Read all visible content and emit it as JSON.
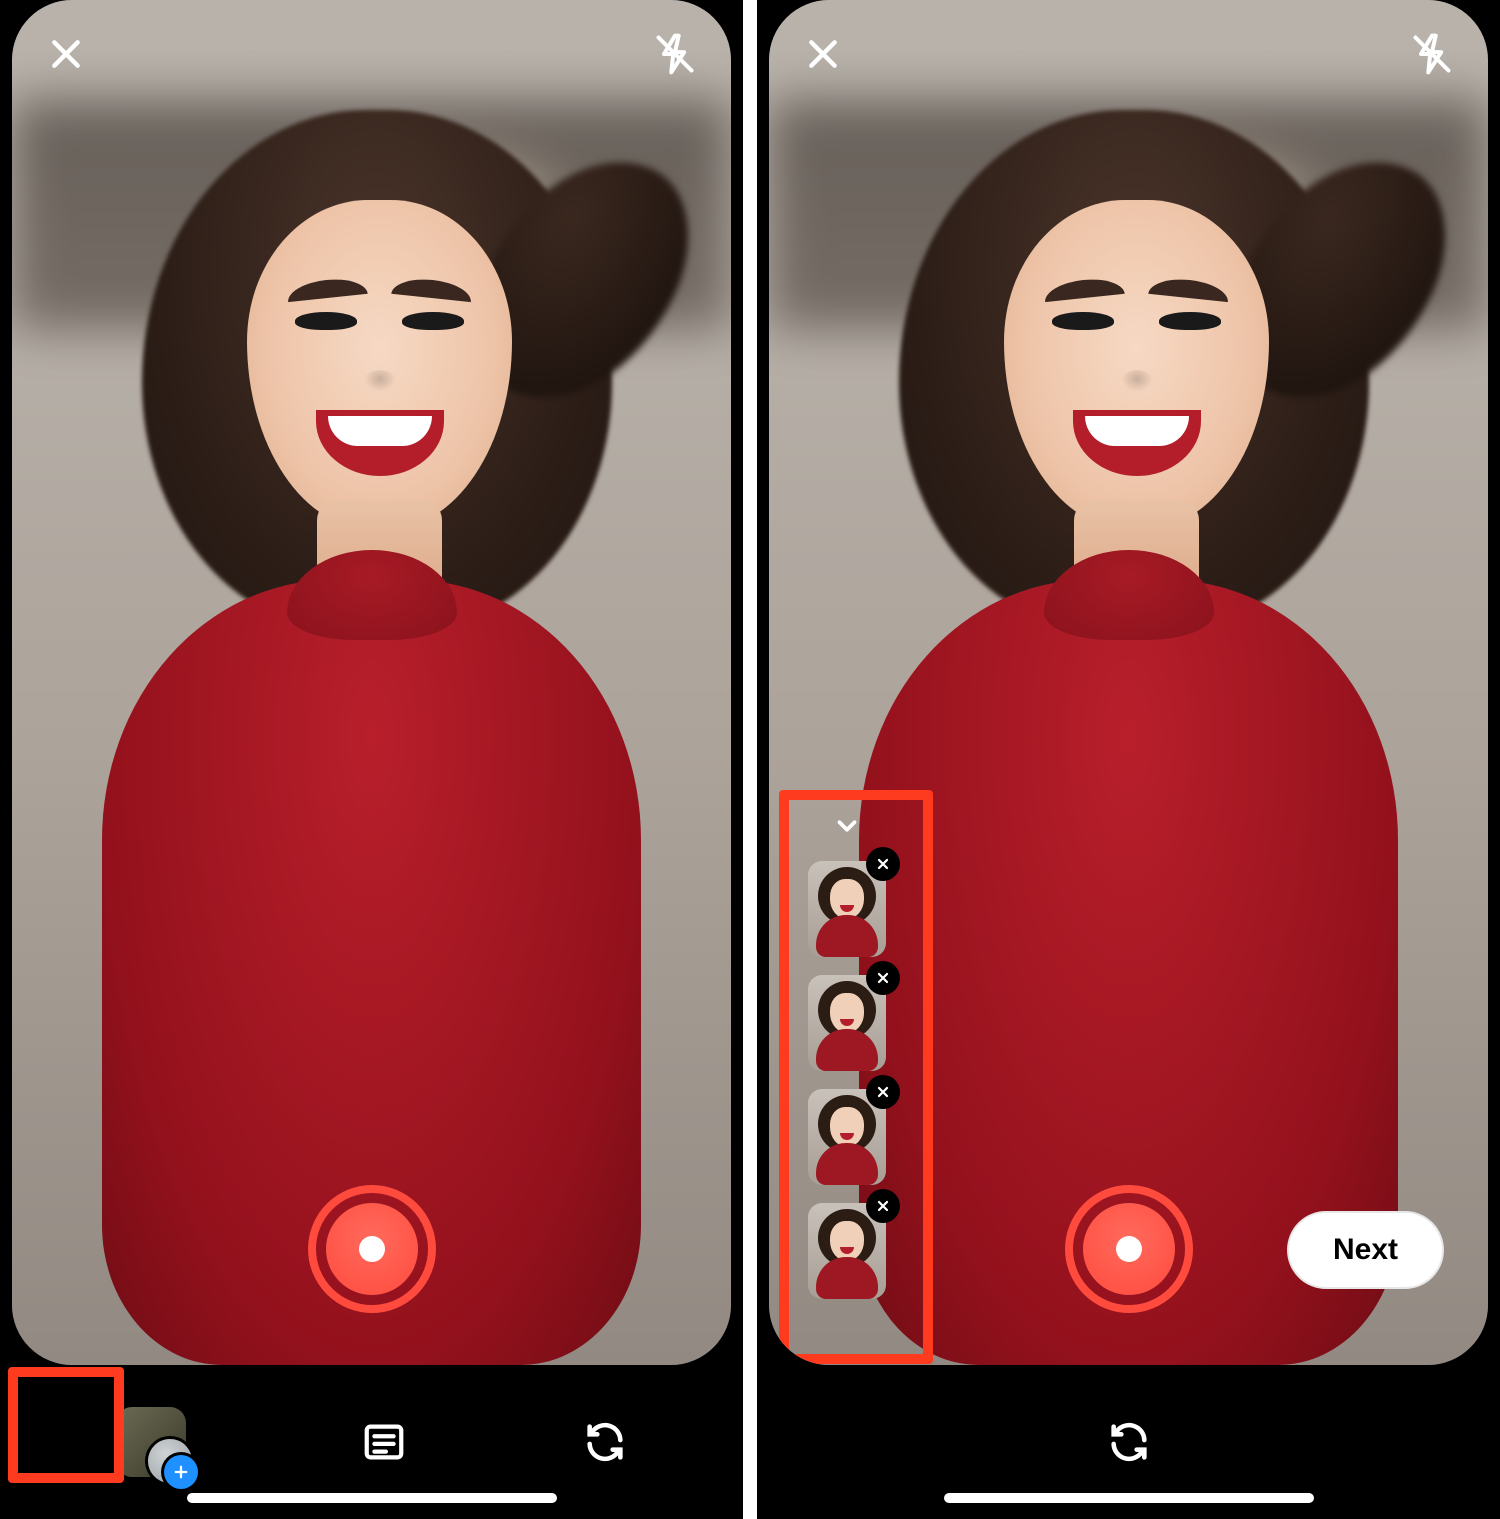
{
  "colors": {
    "accent": "#ff4b3e",
    "highlight": "#ff3b1f",
    "plus": "#1e90ff"
  },
  "left": {
    "close_icon": "close-icon",
    "flash_icon": "flash-off-icon",
    "shutter_icon": "record-shutter",
    "bottom": {
      "gallery_icon": "gallery-add-icon",
      "caption_icon": "text-card-icon",
      "switch_icon": "switch-camera-icon"
    }
  },
  "right": {
    "close_icon": "close-icon",
    "flash_icon": "flash-off-icon",
    "shutter_icon": "record-shutter",
    "next_label": "Next",
    "collapse_icon": "chevron-down-icon",
    "thumbs": [
      {
        "remove_icon": "remove-icon"
      },
      {
        "remove_icon": "remove-icon"
      },
      {
        "remove_icon": "remove-icon"
      },
      {
        "remove_icon": "remove-icon"
      }
    ],
    "bottom": {
      "switch_icon": "switch-camera-icon"
    }
  }
}
